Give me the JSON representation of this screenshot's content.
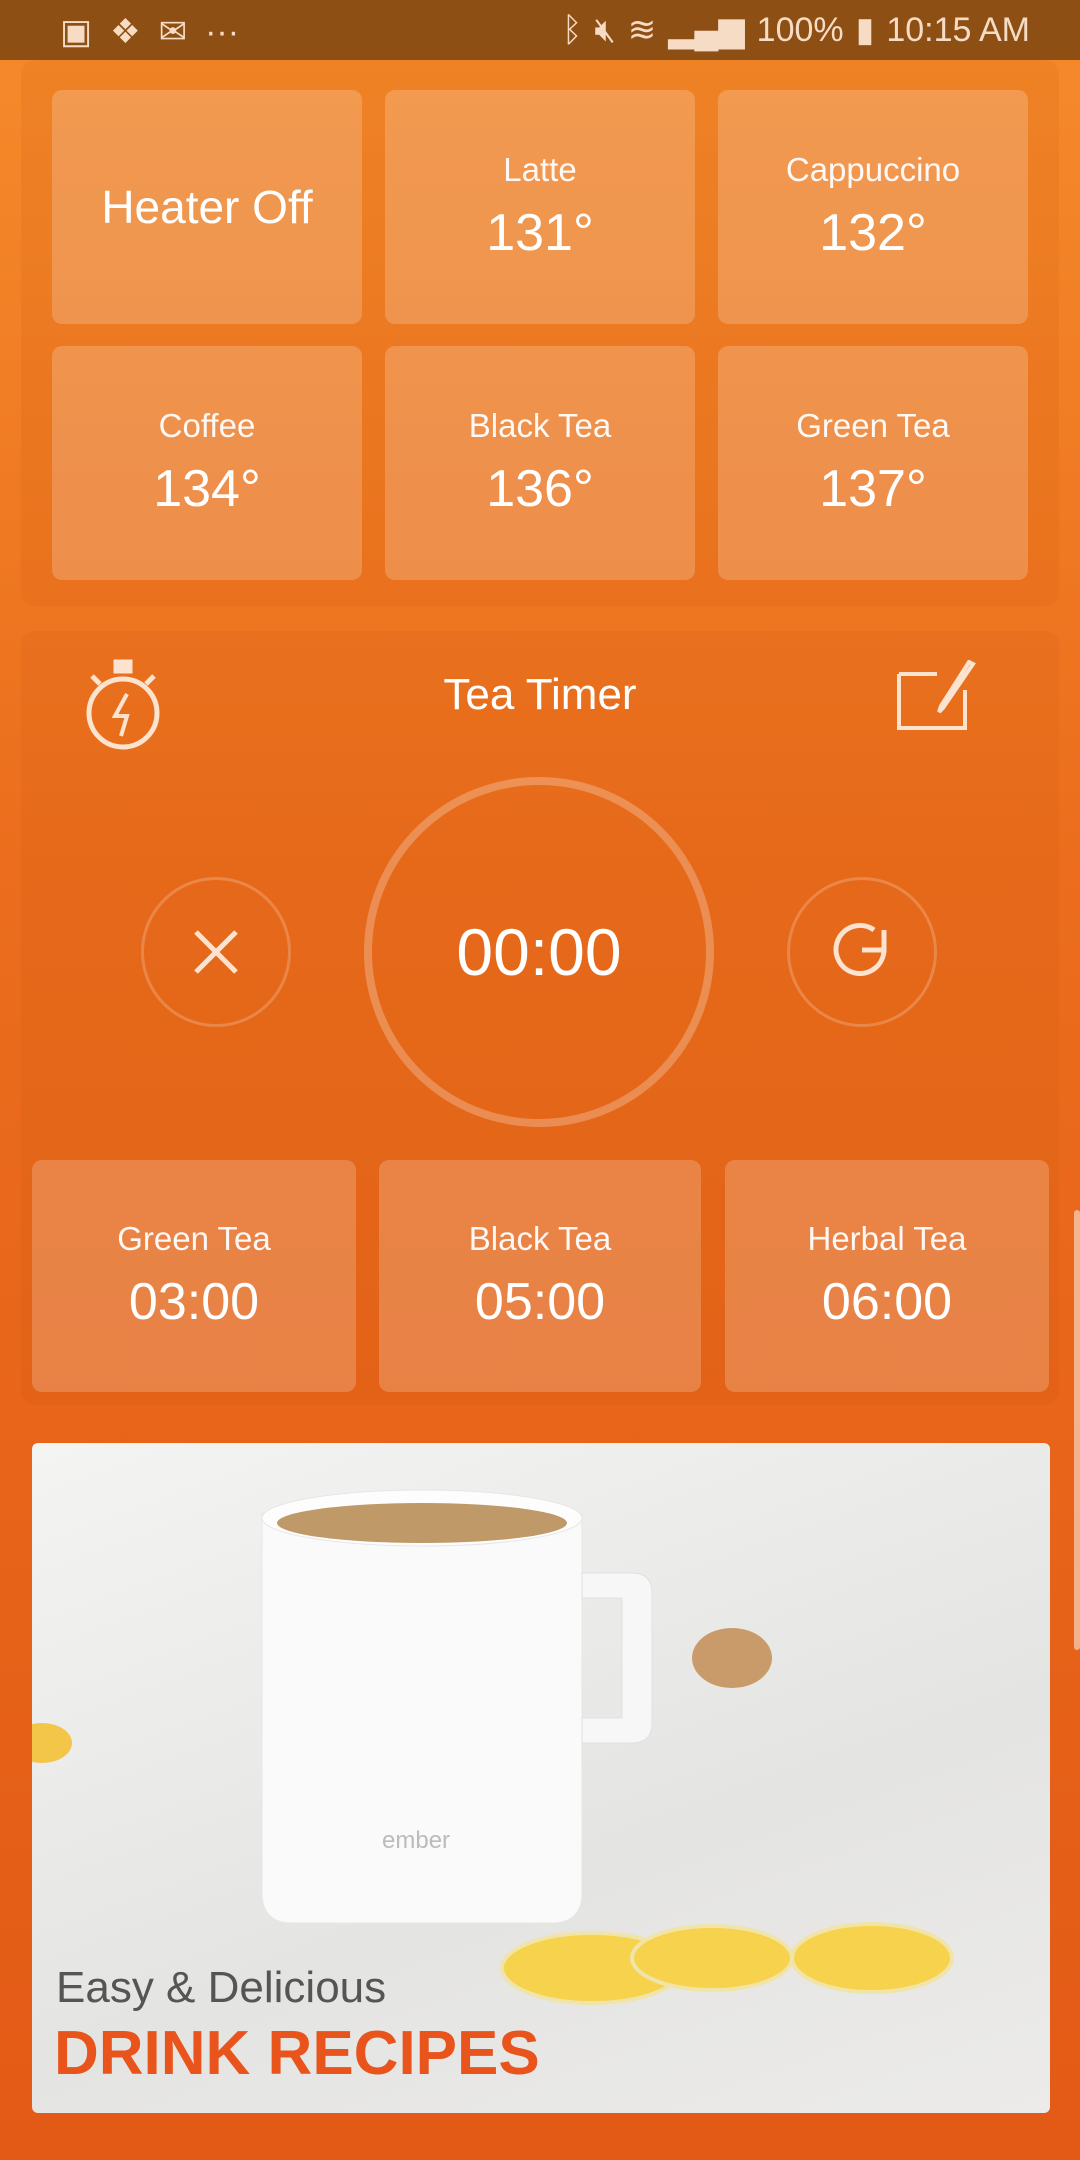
{
  "status_bar": {
    "battery": "100%",
    "time": "10:15 AM",
    "icons": [
      "gallery-icon",
      "dropbox-icon",
      "email-icon",
      "more-icon",
      "bluetooth-icon",
      "mute-icon",
      "wifi-icon",
      "signal-icon",
      "battery-icon"
    ]
  },
  "presets": {
    "tiles": [
      {
        "label": "Heater Off"
      },
      {
        "label": "Latte",
        "value": "131°"
      },
      {
        "label": "Cappuccino",
        "value": "132°"
      },
      {
        "label": "Coffee",
        "value": "134°"
      },
      {
        "label": "Black Tea",
        "value": "136°"
      },
      {
        "label": "Green Tea",
        "value": "137°"
      }
    ]
  },
  "timer": {
    "title": "Tea Timer",
    "display": "00:00",
    "presets": [
      {
        "label": "Green Tea",
        "value": "03:00"
      },
      {
        "label": "Black Tea",
        "value": "05:00"
      },
      {
        "label": "Herbal Tea",
        "value": "06:00"
      }
    ]
  },
  "recipes": {
    "subtitle": "Easy & Delicious",
    "title": "DRINK RECIPES",
    "mug_logo": "ember",
    "accent": "#e8541c"
  }
}
